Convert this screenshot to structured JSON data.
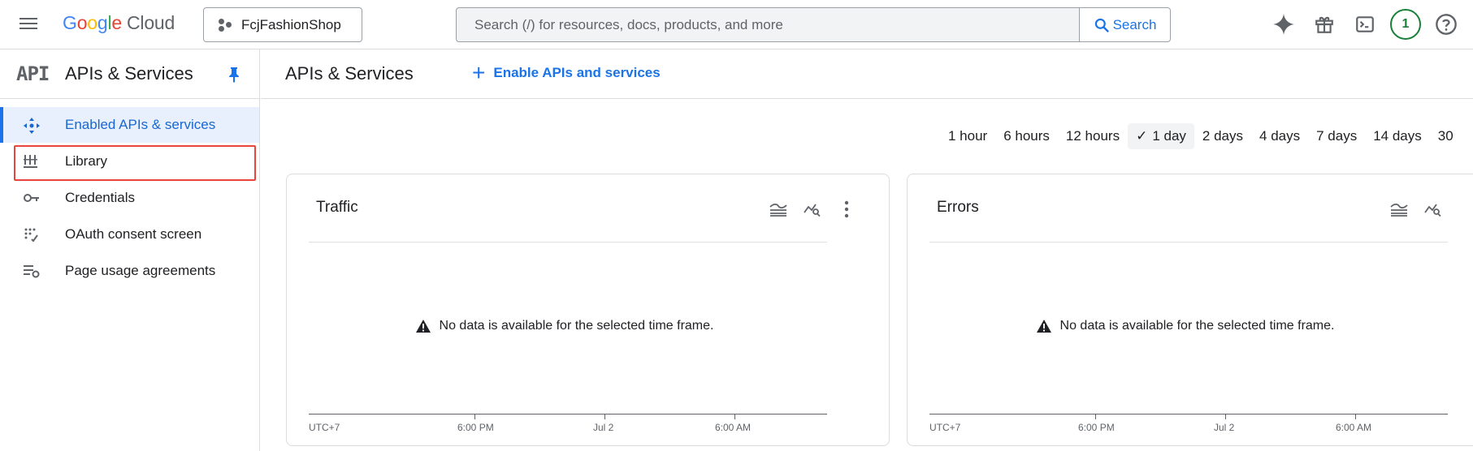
{
  "topbar": {
    "logo": {
      "g1": "G",
      "g2": "o",
      "g3": "o",
      "g4": "g",
      "g5": "l",
      "g6": "e",
      "cloud": "Cloud"
    },
    "project": "FcjFashionShop",
    "search_placeholder": "Search (/) for resources, docs, products, and more",
    "search_button": "Search",
    "notification_count": "1",
    "icons": [
      "menu-icon",
      "project-icon",
      "search-icon",
      "gemini-icon",
      "gift-icon",
      "cloud-shell-icon",
      "help-icon"
    ]
  },
  "sidebar": {
    "logo": "API",
    "title": "APIs & Services",
    "items": [
      {
        "label": "Enabled APIs & services",
        "icon": "enabled-apis-icon",
        "active": true
      },
      {
        "label": "Library",
        "icon": "library-icon",
        "active": false
      },
      {
        "label": "Credentials",
        "icon": "key-icon",
        "active": false
      },
      {
        "label": "OAuth consent screen",
        "icon": "oauth-icon",
        "active": false
      },
      {
        "label": "Page usage agreements",
        "icon": "settings-list-icon",
        "active": false
      }
    ]
  },
  "main": {
    "title": "APIs & Services",
    "enable_button": "Enable APIs and services",
    "time_options": [
      "1 hour",
      "6 hours",
      "12 hours",
      "1 day",
      "2 days",
      "4 days",
      "7 days",
      "14 days",
      "30"
    ],
    "selected_time": "1 day"
  },
  "cards": [
    {
      "title": "Traffic",
      "message": "No data is available for the selected time frame.",
      "axis": [
        "UTC+7",
        "6:00 PM",
        "Jul 2",
        "6:00 AM"
      ]
    },
    {
      "title": "Errors",
      "message": "No data is available for the selected time frame.",
      "axis": [
        "UTC+7",
        "6:00 PM",
        "Jul 2",
        "6:00 AM"
      ]
    }
  ],
  "colors": {
    "accent": "#1a73e8",
    "active_bg": "#e8f0fe",
    "highlight": "#e8453c",
    "notif": "#188038"
  }
}
